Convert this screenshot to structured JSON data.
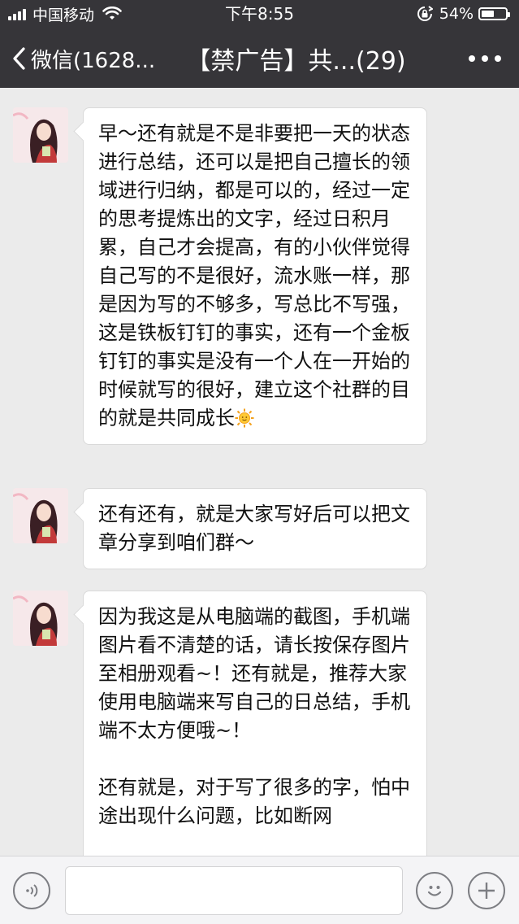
{
  "status_bar": {
    "carrier": "中国移动",
    "time": "下午8:55",
    "battery_text": "54%",
    "battery_level": 0.54
  },
  "nav": {
    "back_label": "微信(1628...",
    "title": "【禁广告】共...(29)"
  },
  "messages": [
    {
      "paragraphs": [
        "早～还有就是不是非要把一天的状态进行总结，还可以是把自己擅长的领域进行归纳，都是可以的，经过一定的思考提炼出的文字，经过日积月累，自己才会提高，有的小伙伴觉得自己写的不是很好，流水账一样，那是因为写的不够多，写总比不写强，这是铁板钉钉的事实，还有一个金板钉钉的事实是没有一个人在一开始的时候就写的很好，建立这个社群的目的就是共同成长"
      ],
      "trailing_emoji": "sun-emoji"
    },
    {
      "paragraphs": [
        "还有还有，就是大家写好后可以把文章分享到咱们群～"
      ]
    },
    {
      "paragraphs": [
        "因为我这是从电脑端的截图，手机端图片看不清楚的话，请长按保存图片至相册观看~！还有就是，推荐大家使用电脑端来写自己的日总结，手机端不太方便哦~！",
        "还有就是，对于写了很多的字，怕中途出现什么问题，比如断网"
      ]
    }
  ],
  "input_bar": {
    "voice_icon": "voice-icon",
    "emoji_icon": "emoji-icon",
    "plus_icon": "plus-icon",
    "text_value": ""
  }
}
